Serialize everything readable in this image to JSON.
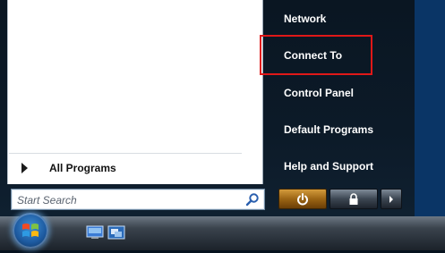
{
  "start_menu": {
    "all_programs_label": "All Programs",
    "search": {
      "placeholder": "Start Search",
      "value": ""
    },
    "right_items": [
      {
        "label": "Network"
      },
      {
        "label": "Connect To"
      },
      {
        "label": "Control Panel"
      },
      {
        "label": "Default Programs"
      },
      {
        "label": "Help and Support"
      }
    ],
    "highlighted_item": "Connect To",
    "power_buttons": [
      {
        "icon": "power-icon"
      },
      {
        "icon": "lock-icon"
      },
      {
        "icon": "arrow-right-icon"
      }
    ]
  },
  "taskbar": {
    "start_orb_icon": "windows-logo-icon",
    "quick_launch_icons": [
      "show-desktop-icon",
      "switch-windows-icon"
    ]
  },
  "colors": {
    "highlight_border": "#e01818",
    "power_button": "#b07420",
    "menu_background": "#0c1a28"
  }
}
